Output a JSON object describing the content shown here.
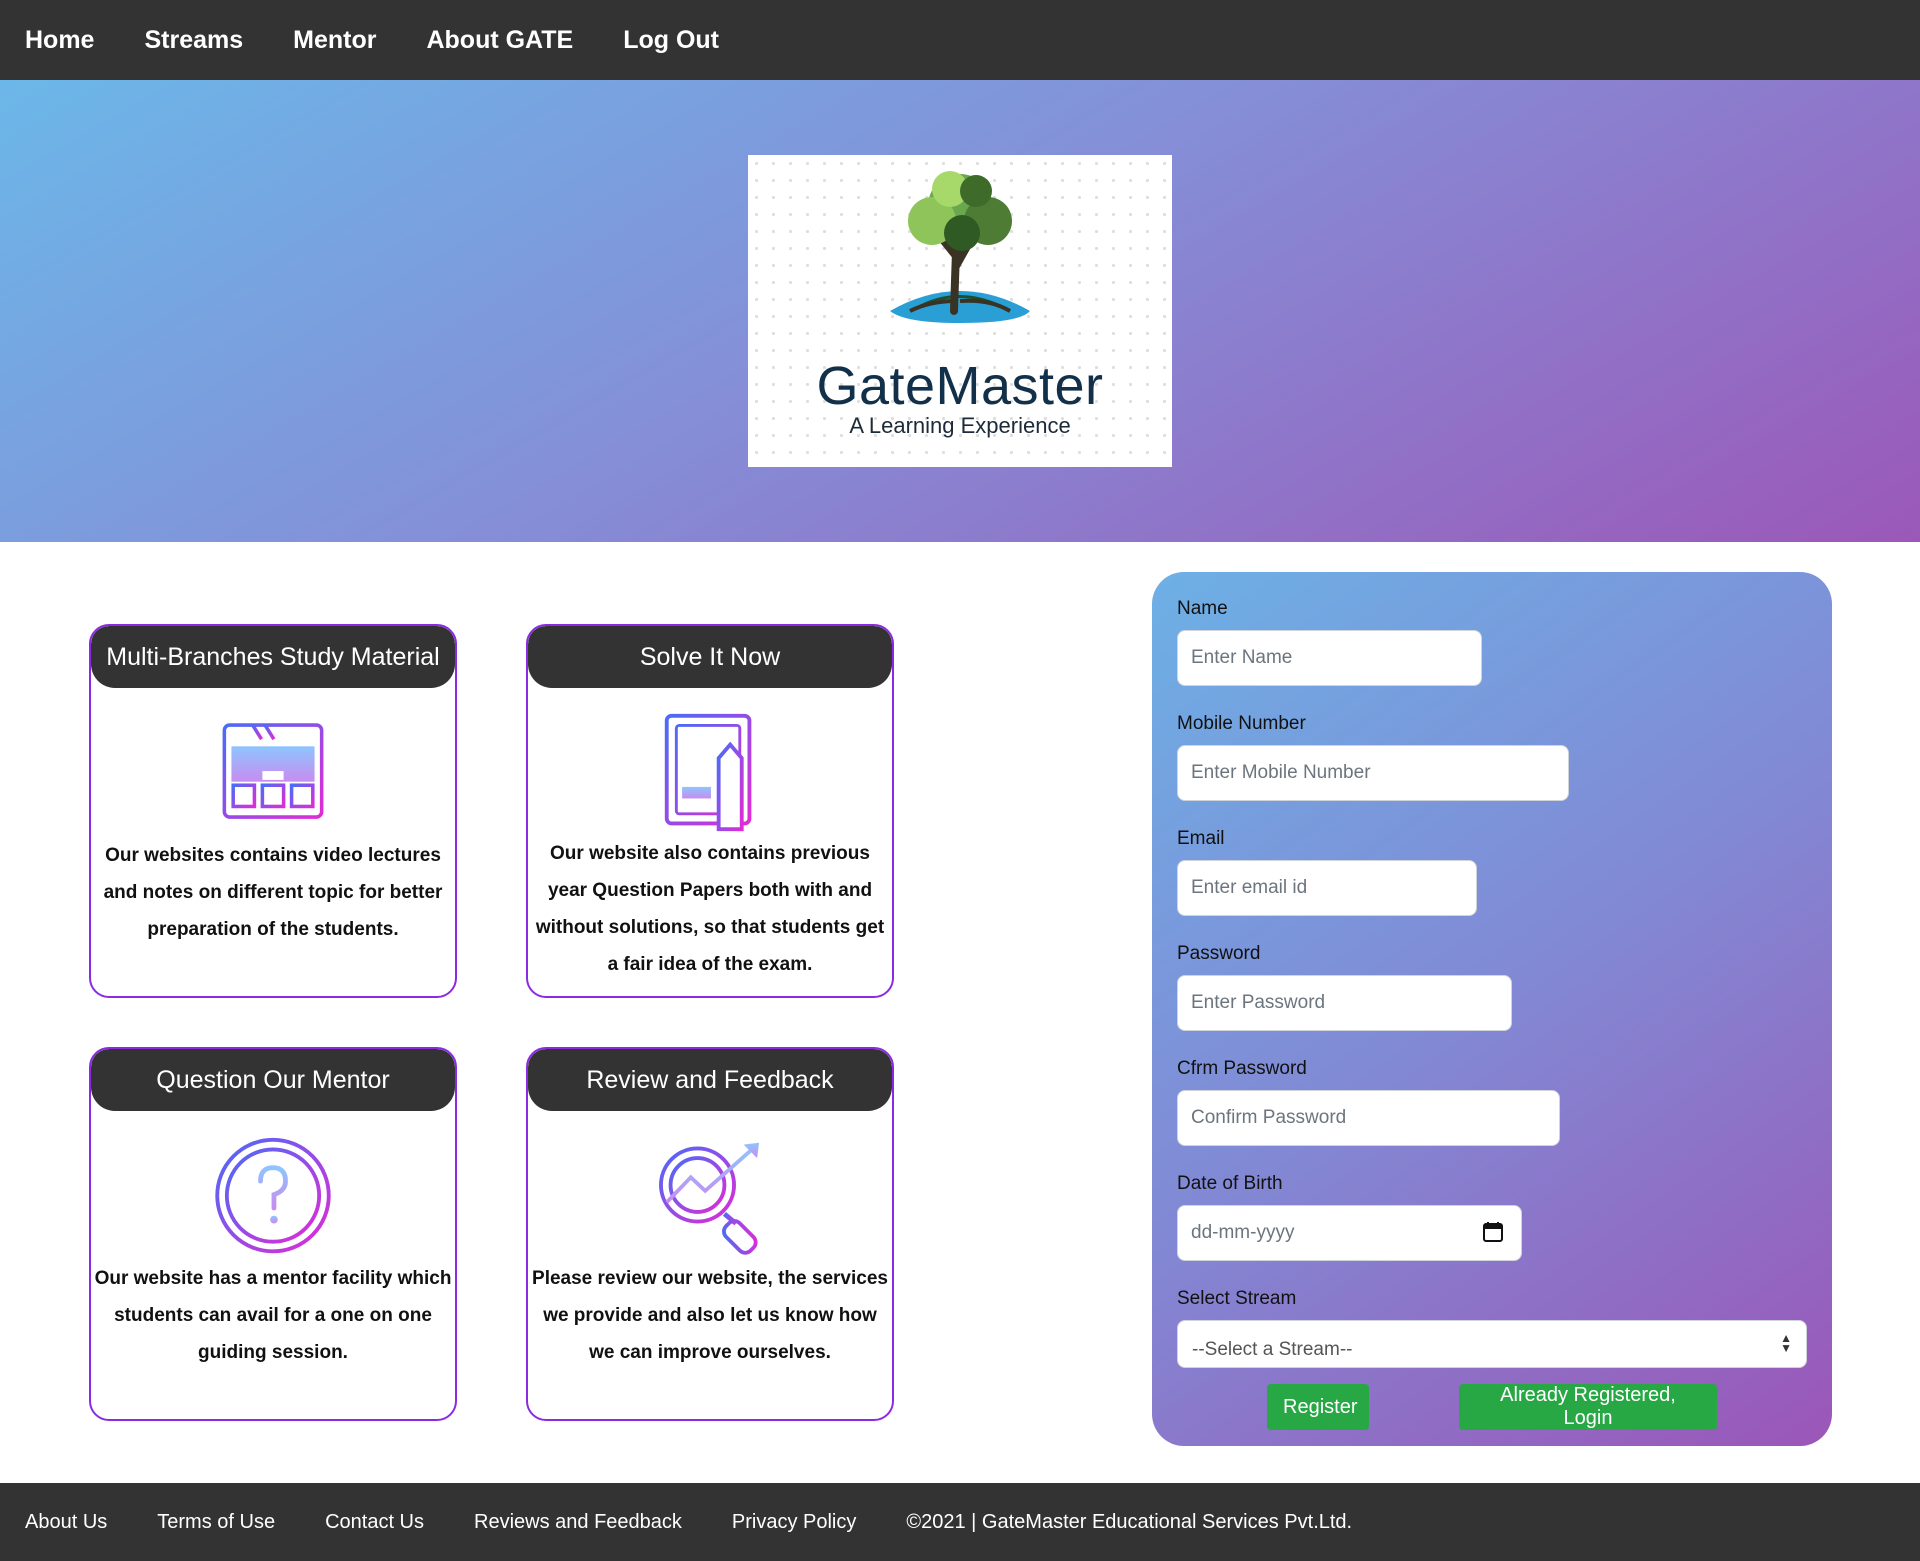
{
  "nav": {
    "items": [
      "Home",
      "Streams",
      "Mentor",
      "About GATE",
      "Log Out"
    ]
  },
  "hero": {
    "logo_title": "GateMaster",
    "logo_subtitle": "A Learning Experience"
  },
  "cards": [
    {
      "title": "Multi-Branches Study Material",
      "icon": "video-player-icon",
      "text": "Our websites contains video lectures and notes on different topic for better preparation of the students."
    },
    {
      "title": "Solve It Now",
      "icon": "document-pencil-icon",
      "text": "Our website also contains previous year Question Papers both with and without solutions, so that students get a fair idea of the exam."
    },
    {
      "title": "Question Our Mentor",
      "icon": "question-circle-icon",
      "text": "Our website has a mentor facility which students can avail for a one on one guiding session."
    },
    {
      "title": "Review and Feedback",
      "icon": "magnifier-chart-icon",
      "text": "Please review our website, the services we provide and also let us know how we can improve ourselves."
    }
  ],
  "form": {
    "name_label": "Name",
    "name_placeholder": "Enter Name",
    "mobile_label": "Mobile Number",
    "mobile_placeholder": "Enter Mobile Number",
    "email_label": "Email",
    "email_placeholder": "Enter email id",
    "password_label": "Password",
    "password_placeholder": "Enter Password",
    "cfrm_label": "Cfrm Password",
    "cfrm_placeholder": "Confirm Password",
    "dob_label": "Date of Birth",
    "dob_placeholder": "dd-mm-yyyy",
    "stream_label": "Select Stream",
    "stream_selected": "--Select a Stream--",
    "register_label": "Register",
    "login_label": "Already Registered, Login"
  },
  "colors": {
    "nav_bg": "#333333",
    "card_border": "#8a2be2",
    "button_green": "#28a745"
  },
  "footer": {
    "links": [
      "About Us",
      "Terms of Use",
      "Contact Us",
      "Reviews and Feedback",
      "Privacy Policy"
    ],
    "copyright": "©2021 | GateMaster Educational Services Pvt.Ltd."
  }
}
